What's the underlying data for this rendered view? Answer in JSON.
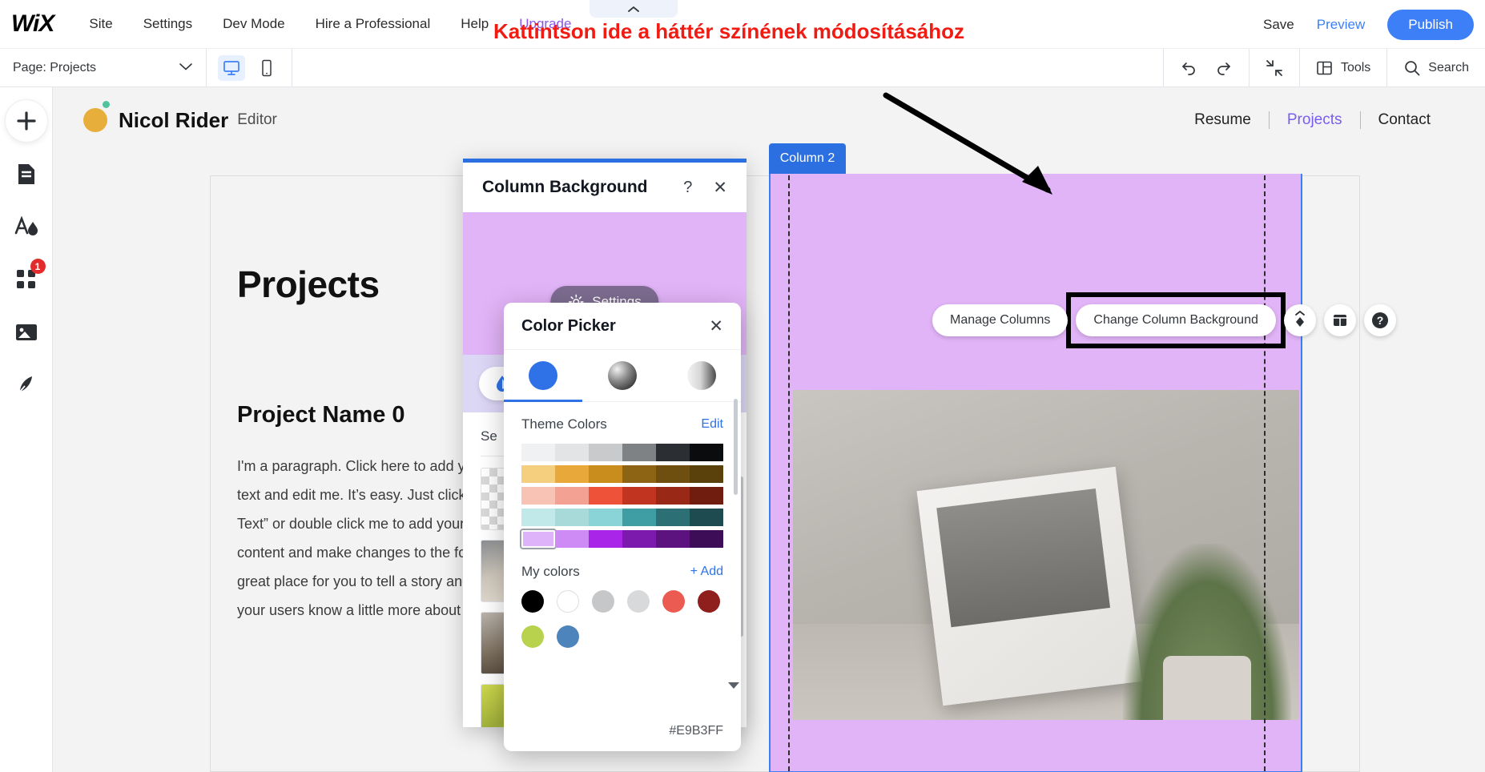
{
  "topbar": {
    "logo": "WiX",
    "menu": [
      "Site",
      "Settings",
      "Dev Mode",
      "Hire a Professional",
      "Help"
    ],
    "upgrade": "Upgrade",
    "save": "Save",
    "preview": "Preview",
    "publish": "Publish",
    "collapse_icon": "chevron-up-icon"
  },
  "annotation": {
    "text": "Kattintson ide a háttér színének módosításához",
    "color": "#f01b12"
  },
  "secondbar": {
    "page_label": "Page: Projects",
    "chevron": "⌄",
    "desktop_icon": "desktop-icon",
    "mobile_icon": "mobile-icon",
    "undo_icon": "undo-icon",
    "redo_icon": "redo-icon",
    "zoomout_icon": "zoom-out-icon",
    "tools_label": "Tools",
    "search_label": "Search"
  },
  "sidebar": {
    "items": [
      {
        "name": "add-elements",
        "icon": "plus-icon",
        "badge": null
      },
      {
        "name": "pages",
        "icon": "page-icon",
        "badge": null
      },
      {
        "name": "theme",
        "icon": "theme-icon",
        "badge": null
      },
      {
        "name": "apps",
        "icon": "apps-icon",
        "badge": "1"
      },
      {
        "name": "media",
        "icon": "image-icon",
        "badge": null
      },
      {
        "name": "content-manager",
        "icon": "pen-icon",
        "badge": null
      }
    ]
  },
  "site": {
    "brand_name": "Nicol Rider",
    "brand_role": "Editor",
    "nav": [
      "Resume",
      "Projects",
      "Contact"
    ],
    "active_nav": "Projects",
    "page_title": "Projects",
    "project_heading": "Project Name 0",
    "project_paragraph": "I'm a paragraph. Click here to add your own text and edit me. It’s easy. Just click “Edit Text” or double click me to add your own content and make changes to the font. It’s a great place for you to tell a story and let your users know a little more about you."
  },
  "column": {
    "label": "Column 2",
    "background_color": "#E9B3FF",
    "toolbar": {
      "manage_columns": "Manage Columns",
      "change_background": "Change Column Background",
      "stretch_icon": "stretch-icon",
      "layout_icon": "layout-icon",
      "help_icon": "help-icon"
    }
  },
  "column_background_panel": {
    "title": "Column Background",
    "help_icon": "?",
    "close_icon": "✕",
    "settings_button": "Settings",
    "settings_icon": "gear-icon",
    "drop_icon": "droplet-icon",
    "section_label": "Se",
    "preview_color": "#E1B3F7"
  },
  "color_picker": {
    "title": "Color Picker",
    "close_icon": "✕",
    "tabs": [
      {
        "name": "solid-color-tab",
        "type": "solid",
        "selected": true
      },
      {
        "name": "gradient-radial-tab",
        "type": "gradient-radial",
        "selected": false
      },
      {
        "name": "gradient-linear-tab",
        "type": "gradient-linear",
        "selected": false
      }
    ],
    "theme_colors_label": "Theme Colors",
    "theme_colors_edit": "Edit",
    "theme_rows": [
      [
        "#f0f1f2",
        "#e3e4e6",
        "#c8cacc",
        "#7e8285",
        "#2b2f33",
        "#0a0c0e"
      ],
      [
        "#f5cf7e",
        "#e9a93a",
        "#c98d1e",
        "#8c6414",
        "#6e4f10",
        "#5a410c"
      ],
      [
        "#f8c2b5",
        "#f3a192",
        "#ee5239",
        "#c1341f",
        "#9a2816",
        "#701c0f"
      ],
      [
        "#c2e9e9",
        "#a9dada",
        "#8ad3d6",
        "#3e9ea3",
        "#2c6f74",
        "#1e4b4f"
      ],
      [
        "#deb3f9",
        "#ce8af5",
        "#a925e8",
        "#7c1aad",
        "#5c1380",
        "#3e0d57"
      ]
    ],
    "my_colors_label": "My colors",
    "my_colors_add": "+ Add",
    "my_colors": [
      "#000000",
      "#ffffff",
      "#c5c7c9",
      "#d7d9db",
      "#ec5b52",
      "#8e1f1d",
      "#b8d24e",
      "#4d84bb"
    ],
    "hex_value": "#E9B3FF"
  }
}
